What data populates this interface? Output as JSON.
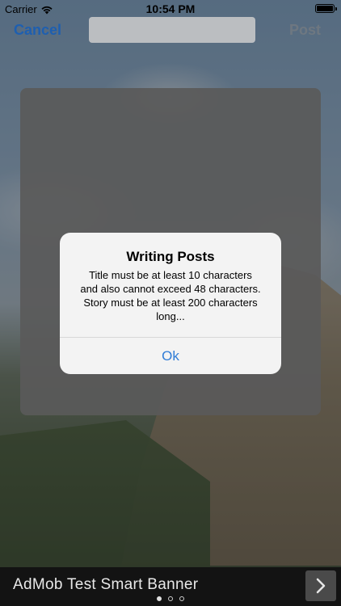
{
  "status_bar": {
    "carrier": "Carrier",
    "time": "10:54 PM",
    "icons": [
      "wifi-icon",
      "battery-icon"
    ]
  },
  "nav": {
    "cancel_label": "Cancel",
    "title_field_value": "",
    "post_label": "Post"
  },
  "alert": {
    "title": "Writing Posts",
    "message": "Title must be at least 10 characters\nand also cannot exceed 48 characters.\nStory must be at least 200 characters\nlong...",
    "ok_label": "Ok"
  },
  "ad_banner": {
    "text": "AdMob Test Smart Banner",
    "arrow_icon": "chevron-right-icon",
    "page_dots": {
      "count": 3,
      "active_index": 0
    }
  },
  "colors": {
    "accent": "#1e5fb0",
    "alert_button": "#2f7cd6",
    "ad_background": "#131313"
  }
}
